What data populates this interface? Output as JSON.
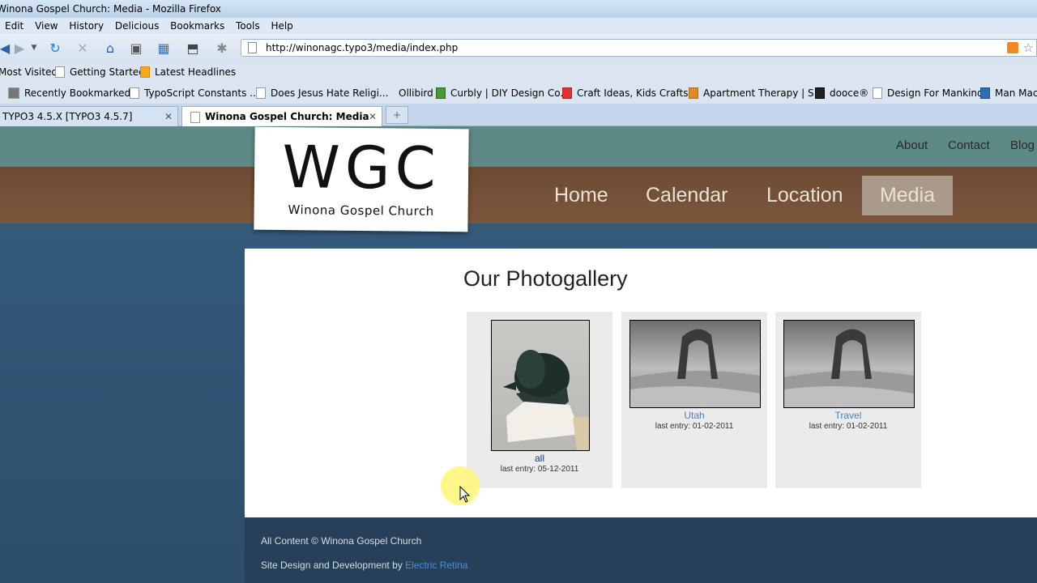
{
  "window": {
    "title": "Winona Gospel Church: Media - Mozilla Firefox"
  },
  "menu": [
    "Edit",
    "View",
    "History",
    "Delicious",
    "Bookmarks",
    "Tools",
    "Help"
  ],
  "url": "http://winonagc.typo3/media/index.php",
  "bookmarks_row1": [
    "Most Visited",
    "Getting Started",
    "Latest Headlines"
  ],
  "bookmarks_row2": [
    "Recently Bookmarked",
    "TypoScript Constants ...",
    "Does Jesus Hate Religi...",
    "Ollibird",
    "Curbly | DIY Design Co...",
    "Craft Ideas, Kids Crafts...",
    "Apartment Therapy | S...",
    "dooce®",
    "Design For Mankind",
    "Man Mac"
  ],
  "tabs": [
    {
      "label": "TYPO3 4.5.X [TYPO3 4.5.7]",
      "active": false
    },
    {
      "label": "Winona Gospel Church: Media",
      "active": true
    }
  ],
  "logo": {
    "main": "WGC",
    "sub": "Winona Gospel Church"
  },
  "subnav": [
    "About",
    "Contact",
    "Blog"
  ],
  "mainnav": [
    "Home",
    "Calendar",
    "Location",
    "Media"
  ],
  "page": {
    "title": "Our Photogallery"
  },
  "galleries": [
    {
      "title": "all",
      "meta": "last entry: 05-12-2011"
    },
    {
      "title": "Utah",
      "meta": "last entry: 01-02-2011"
    },
    {
      "title": "Travel",
      "meta": "last entry: 01-02-2011"
    }
  ],
  "footer": {
    "line1": "All Content © Winona Gospel Church",
    "line2_prefix": "Site Design and Development by ",
    "line2_link": "Electric Retina"
  },
  "colors": {
    "link": "#4a90d9",
    "active_nav": "#a99a8c",
    "footer_bg": "#26405a"
  }
}
